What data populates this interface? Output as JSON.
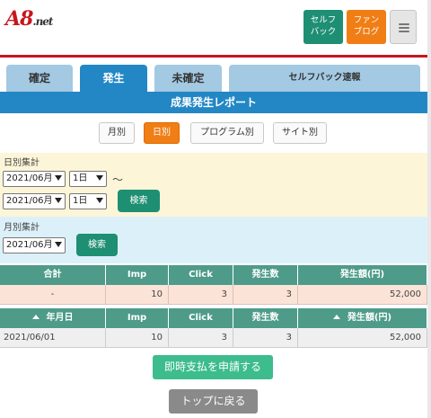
{
  "header": {
    "logo_main": "A8",
    "logo_suffix": ".net",
    "self_back_label": "セルフ\nバック",
    "fan_blog_label": "ファン\nブログ",
    "colors": {
      "brand_red": "#c8161d",
      "self_back": "#1e8f73",
      "fan_blog": "#f07e15"
    },
    "menu_icon": "hamburger-icon"
  },
  "tabs": [
    {
      "label": "確定",
      "active": false
    },
    {
      "label": "発生",
      "active": true
    },
    {
      "label": "未確定",
      "active": false
    },
    {
      "label": "セルフバック速報",
      "active": false
    }
  ],
  "report_title": "成果発生レポート",
  "period_buttons": [
    {
      "label": "月別",
      "active": false
    },
    {
      "label": "日別",
      "active": true
    },
    {
      "label": "プログラム別",
      "active": false
    },
    {
      "label": "サイト別",
      "active": false
    }
  ],
  "daily": {
    "label": "日別集計",
    "from_month": "2021/06月",
    "from_day": "1日",
    "separator": "～",
    "to_month": "2021/06月",
    "to_day": "1日",
    "search_label": "検索"
  },
  "monthly": {
    "label": "月別集計",
    "month": "2021/06月",
    "search_label": "検索"
  },
  "summary_table": {
    "headers": [
      "合計",
      "Imp",
      "Click",
      "発生数",
      "発生額(円)"
    ],
    "row": [
      "-",
      "10",
      "3",
      "3",
      "52,000"
    ]
  },
  "daily_table": {
    "headers": [
      "年月日",
      "Imp",
      "Click",
      "発生数",
      "発生額(円)"
    ],
    "rows": [
      [
        "2021/06/01",
        "10",
        "3",
        "3",
        "52,000"
      ]
    ]
  },
  "actions": {
    "apply_label": "即時支払を申請する",
    "top_label": "トップに戻る"
  }
}
